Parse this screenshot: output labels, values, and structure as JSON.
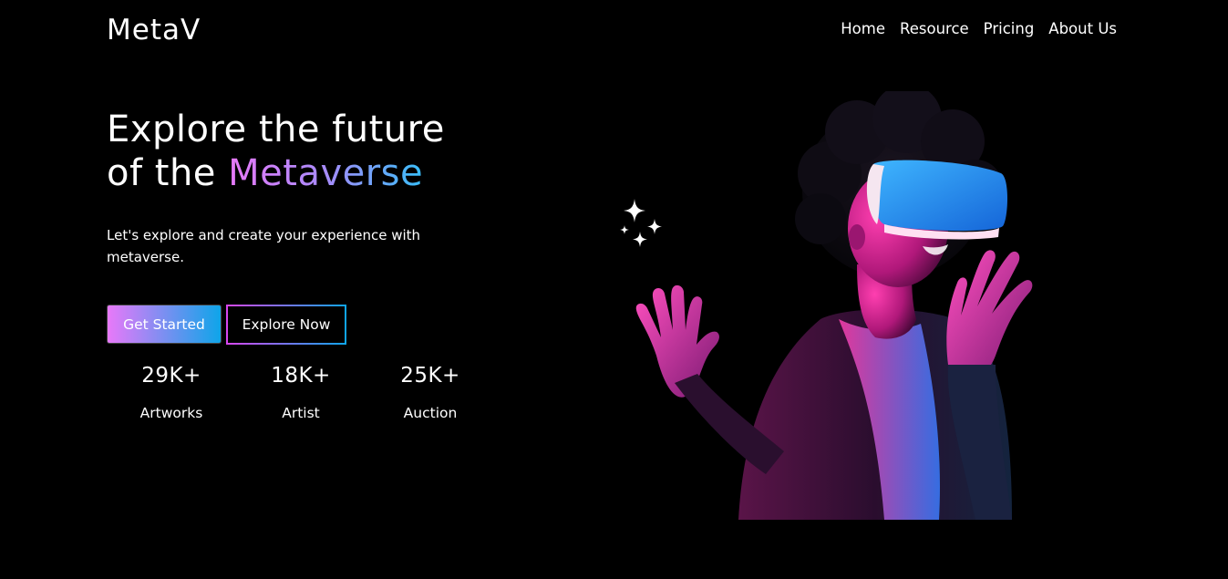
{
  "brand": {
    "logo": "MetaV"
  },
  "nav": {
    "items": [
      {
        "label": "Home"
      },
      {
        "label": "Resource"
      },
      {
        "label": "Pricing"
      },
      {
        "label": "About Us"
      }
    ]
  },
  "hero": {
    "title_line1": "Explore the future",
    "title_line2_prefix": "of the ",
    "title_line2_highlight": "Metaverse",
    "subtitle": "Let's explore and create your experience with metaverse.",
    "primary_button": "Get Started",
    "secondary_button": "Explore Now",
    "image_icon": "vr-headset-person-illustration",
    "sparkle_icon": "sparkles-icon"
  },
  "stats": [
    {
      "value": "29K+",
      "label": "Artworks"
    },
    {
      "value": "18K+",
      "label": "Artist"
    },
    {
      "value": "25K+",
      "label": "Auction"
    }
  ],
  "colors": {
    "background": "#000000",
    "text": "#ffffff",
    "accent_pink": "#e879f9",
    "accent_purple": "#a78bfa",
    "accent_blue": "#0ea5e9"
  }
}
